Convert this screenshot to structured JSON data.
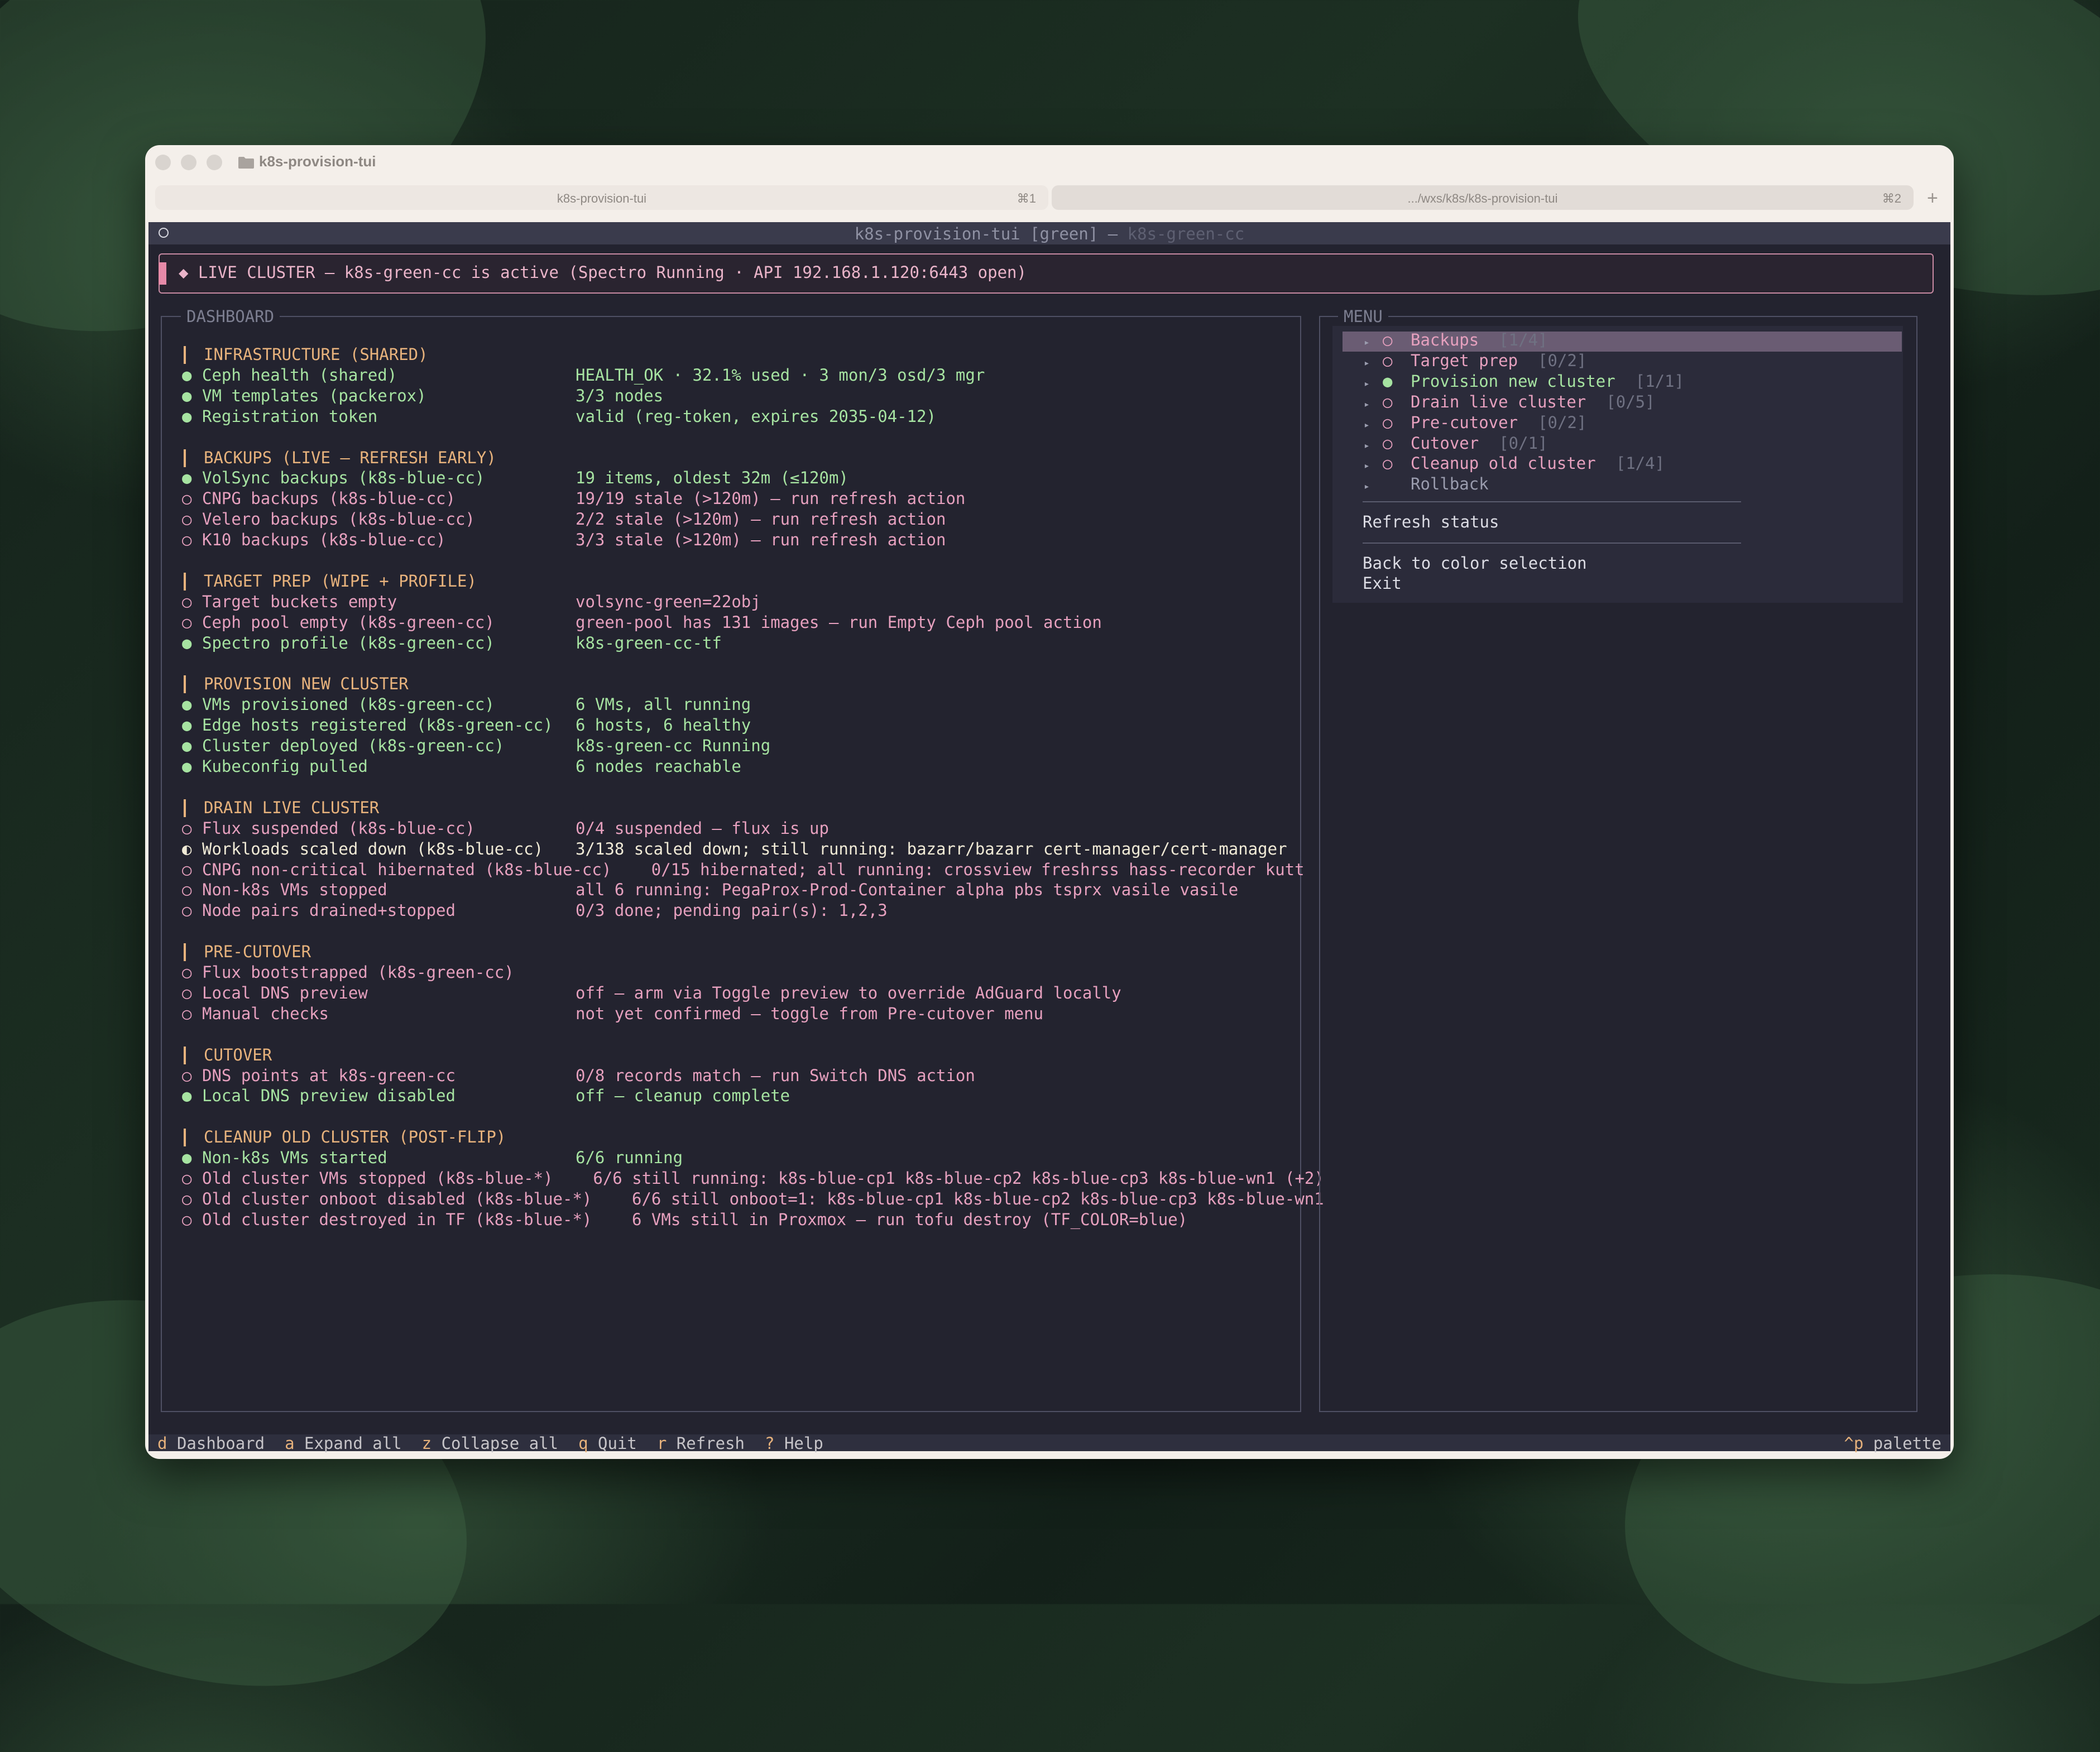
{
  "window": {
    "title": "k8s-provision-tui"
  },
  "tabs": [
    {
      "label": "k8s-provision-tui",
      "shortcut": "⌘1"
    },
    {
      "label": ".../wxs/k8s/k8s-provision-tui",
      "shortcut": "⌘2"
    }
  ],
  "new_tab": "+",
  "terminal": {
    "title_main": "k8s-provision-tui [green] — ",
    "title_dim": "k8s-green-cc",
    "alert": "◆ LIVE CLUSTER — k8s-green-cc is active (Spectro Running · API 192.168.1.120:6443 open)"
  },
  "dashboard": {
    "title": "DASHBOARD",
    "sections": [
      {
        "title": "INFRASTRUCTURE (SHARED)",
        "items": [
          {
            "bullet": "●",
            "state": "ok",
            "label": "Ceph health (shared)",
            "status": "HEALTH_OK · 32.1% used · 3 mon/3 osd/3 mgr"
          },
          {
            "bullet": "●",
            "state": "ok",
            "label": "VM templates (packerox)",
            "status": "3/3 nodes"
          },
          {
            "bullet": "●",
            "state": "ok",
            "label": "Registration token",
            "status": "valid (reg-token, expires 2035-04-12)"
          }
        ]
      },
      {
        "title": "BACKUPS (LIVE — REFRESH EARLY)",
        "items": [
          {
            "bullet": "●",
            "state": "ok",
            "label": "VolSync backups (k8s-blue-cc)",
            "status": "19 items, oldest 32m (≤120m)"
          },
          {
            "bullet": "○",
            "state": "pend",
            "label": "CNPG backups (k8s-blue-cc)",
            "status": "19/19 stale (>120m) — run refresh action"
          },
          {
            "bullet": "○",
            "state": "pend",
            "label": "Velero backups (k8s-blue-cc)",
            "status": "2/2 stale (>120m) — run refresh action"
          },
          {
            "bullet": "○",
            "state": "pend",
            "label": "K10 backups (k8s-blue-cc)",
            "status": "3/3 stale (>120m) — run refresh action"
          }
        ]
      },
      {
        "title": "TARGET PREP (WIPE + PROFILE)",
        "items": [
          {
            "bullet": "○",
            "state": "pend",
            "label": "Target buckets empty",
            "status": "volsync-green=22obj"
          },
          {
            "bullet": "○",
            "state": "pend",
            "label": "Ceph pool empty (k8s-green-cc)",
            "status": "green-pool has 131 images — run Empty Ceph pool action"
          },
          {
            "bullet": "●",
            "state": "ok",
            "label": "Spectro profile (k8s-green-cc)",
            "status": "k8s-green-cc-tf"
          }
        ]
      },
      {
        "title": "PROVISION NEW CLUSTER",
        "items": [
          {
            "bullet": "●",
            "state": "ok",
            "label": "VMs provisioned (k8s-green-cc)",
            "status": "6 VMs, all running"
          },
          {
            "bullet": "●",
            "state": "ok",
            "label": "Edge hosts registered (k8s-green-cc)",
            "status": "6 hosts, 6 healthy"
          },
          {
            "bullet": "●",
            "state": "ok",
            "label": "Cluster deployed (k8s-green-cc)",
            "status": "k8s-green-cc Running"
          },
          {
            "bullet": "●",
            "state": "ok",
            "label": "Kubeconfig pulled",
            "status": "6 nodes reachable"
          }
        ]
      },
      {
        "title": "DRAIN LIVE CLUSTER",
        "items": [
          {
            "bullet": "○",
            "state": "pend",
            "label": "Flux suspended (k8s-blue-cc)",
            "status": "0/4 suspended — flux is up"
          },
          {
            "bullet": "◐",
            "state": "half",
            "label": "Workloads scaled down (k8s-blue-cc)",
            "status": "3/138 scaled down; still running: bazarr/bazarr cert-manager/cert-manager"
          },
          {
            "bullet": "○",
            "state": "pend",
            "label": "CNPG non-critical hibernated (k8s-blue-cc)",
            "status": "0/15 hibernated; all running: crossview freshrss hass-recorder kutt",
            "tight": true
          },
          {
            "bullet": "○",
            "state": "pend",
            "label": "Non-k8s VMs stopped",
            "status": "all 6 running: PegaProx-Prod-Container alpha pbs tsprx vasile vasile"
          },
          {
            "bullet": "○",
            "state": "pend",
            "label": "Node pairs drained+stopped",
            "status": "0/3 done; pending pair(s): 1,2,3"
          }
        ]
      },
      {
        "title": "PRE-CUTOVER",
        "items": [
          {
            "bullet": "○",
            "state": "pend",
            "label": "Flux bootstrapped (k8s-green-cc)",
            "status": ""
          },
          {
            "bullet": "○",
            "state": "pend",
            "label": "Local DNS preview",
            "status": "off — arm via Toggle preview to override AdGuard locally"
          },
          {
            "bullet": "○",
            "state": "pend",
            "label": "Manual checks",
            "status": "not yet confirmed — toggle from Pre-cutover menu"
          }
        ]
      },
      {
        "title": "CUTOVER",
        "items": [
          {
            "bullet": "○",
            "state": "pend",
            "label": "DNS points at k8s-green-cc",
            "status": "0/8 records match — run Switch DNS action"
          },
          {
            "bullet": "●",
            "state": "ok",
            "label": "Local DNS preview disabled",
            "status": "off — cleanup complete"
          }
        ]
      },
      {
        "title": "CLEANUP OLD CLUSTER (POST-FLIP)",
        "items": [
          {
            "bullet": "●",
            "state": "ok",
            "label": "Non-k8s VMs started",
            "status": "6/6 running"
          },
          {
            "bullet": "○",
            "state": "pend",
            "label": "Old cluster VMs stopped (k8s-blue-*)",
            "status": "6/6 still running: k8s-blue-cp1 k8s-blue-cp2 k8s-blue-cp3 k8s-blue-wn1 (+2)",
            "tight": true
          },
          {
            "bullet": "○",
            "state": "pend",
            "label": "Old cluster onboot disabled (k8s-blue-*)",
            "status": "6/6 still onboot=1: k8s-blue-cp1 k8s-blue-cp2 k8s-blue-cp3 k8s-blue-wn1",
            "tight": true
          },
          {
            "bullet": "○",
            "state": "pend",
            "label": "Old cluster destroyed in TF (k8s-blue-*)",
            "status": "6 VMs still in Proxmox — run tofu destroy (TF_COLOR=blue)",
            "tight": true
          }
        ]
      }
    ]
  },
  "menu": {
    "title": "MENU",
    "items": [
      {
        "arrow": "▸",
        "bullet": "○",
        "label": "Backups",
        "count": "[1/4]",
        "state": "pend",
        "selected": true
      },
      {
        "arrow": "▸",
        "bullet": "○",
        "label": "Target prep",
        "count": "[0/2]",
        "state": "pend"
      },
      {
        "arrow": "▸",
        "bullet": "●",
        "label": "Provision new cluster",
        "count": "[1/1]",
        "state": "ok"
      },
      {
        "arrow": "▸",
        "bullet": "○",
        "label": "Drain live cluster",
        "count": "[0/5]",
        "state": "pend"
      },
      {
        "arrow": "▸",
        "bullet": "○",
        "label": "Pre-cutover",
        "count": "[0/2]",
        "state": "pend"
      },
      {
        "arrow": "▸",
        "bullet": "○",
        "label": "Cutover",
        "count": "[0/1]",
        "state": "pend"
      },
      {
        "arrow": "▸",
        "bullet": "○",
        "label": "Cleanup old cluster",
        "count": "[1/4]",
        "state": "pend"
      },
      {
        "arrow": "▸",
        "bullet": "",
        "label": "Rollback",
        "count": "",
        "state": "dim"
      }
    ],
    "refresh": "Refresh status",
    "back": "Back to color selection",
    "exit": "Exit"
  },
  "footer": {
    "keys": [
      {
        "key": "d",
        "label": "Dashboard"
      },
      {
        "key": "a",
        "label": "Expand all"
      },
      {
        "key": "z",
        "label": "Collapse all"
      },
      {
        "key": "q",
        "label": "Quit"
      },
      {
        "key": "r",
        "label": "Refresh"
      },
      {
        "key": "?",
        "label": "Help"
      }
    ],
    "palette_key": "^p",
    "palette_label": "palette"
  },
  "colors": {
    "ok": "#a6e3a1",
    "pending": "#e6a0be",
    "section": "#e7b27c",
    "alert": "#eab4c9"
  }
}
